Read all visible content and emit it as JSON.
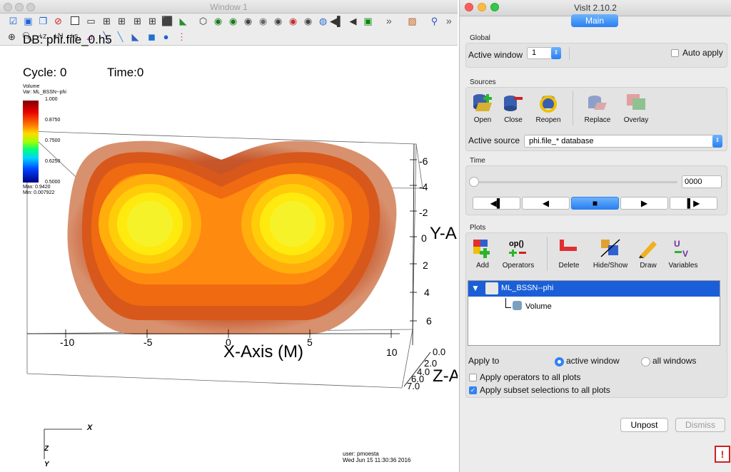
{
  "viewer": {
    "window_title": "Window 1",
    "db_label": "DB: phi.file_0.h5",
    "cycle_label": "Cycle: 0",
    "time_label": "Time:0",
    "legend": {
      "title_line1": "Volume",
      "title_line2": "Var: ML_BSSN--phi",
      "ticks": [
        "1.000",
        "0.8750",
        "0.7500",
        "0.6250",
        "0.5000"
      ],
      "max_label": "Max:  0.9420",
      "min_label": "Min:  0.007922"
    },
    "axes": {
      "x_title": "X-Axis (M)",
      "y_title": "Y-A",
      "z_title": "Z-A",
      "x_ticks": [
        "-10",
        "-5",
        "0",
        "5",
        "10"
      ],
      "y_ticks": [
        "-6",
        "-4",
        "-2",
        "0",
        "2",
        "4",
        "6"
      ],
      "z_ticks": [
        "0.0",
        "2.0",
        "4.0",
        "6.0",
        "7.0"
      ]
    },
    "triad": {
      "x": "X",
      "y": "Y",
      "z": "Z"
    },
    "user_line1": "user: pmoesta",
    "user_line2": "Wed Jun 15 11:30:36 2016"
  },
  "main": {
    "window_title": "VisIt 2.10.2",
    "tab_label": "Main",
    "global": {
      "title": "Global",
      "active_window_label": "Active window",
      "active_window_value": "1",
      "auto_apply_label": "Auto apply"
    },
    "sources": {
      "title": "Sources",
      "buttons": [
        "Open",
        "Close",
        "Reopen",
        "Replace",
        "Overlay"
      ],
      "active_source_label": "Active source",
      "active_source_value": "phi.file_* database"
    },
    "time": {
      "title": "Time",
      "frame_value": "0000",
      "controls": [
        "◀▌",
        "◀",
        "■",
        "▶",
        "▌▶"
      ]
    },
    "plots": {
      "title": "Plots",
      "buttons": [
        "Add",
        "Operators",
        "Delete",
        "Hide/Show",
        "Draw",
        "Variables"
      ],
      "plot_name": "ML_BSSN--phi",
      "plot_child": "Volume",
      "apply_to_label": "Apply to",
      "radio_active": "active window",
      "radio_all": "all windows",
      "apply_operators_label": "Apply operators to all plots",
      "apply_subset_label": "Apply subset selections to all plots"
    },
    "unpost_label": "Unpost",
    "dismiss_label": "Dismiss",
    "colors": {
      "accent": "#2a7ff2",
      "selection": "#1a5fd8"
    }
  }
}
